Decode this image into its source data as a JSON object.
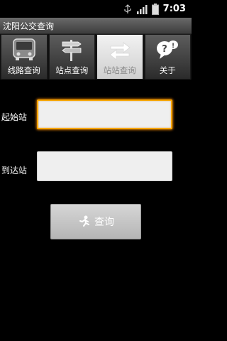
{
  "status_bar": {
    "time": "7:03",
    "icons": [
      "usb-icon",
      "signal-icon",
      "battery-icon"
    ]
  },
  "app": {
    "title": "沈阳公交查询"
  },
  "tabs": [
    {
      "label": "线路查询",
      "icon": "bus-icon",
      "active": false
    },
    {
      "label": "站点查询",
      "icon": "signpost-icon",
      "active": false
    },
    {
      "label": "站站查询",
      "icon": "swap-arrows-icon",
      "active": true
    },
    {
      "label": "关于",
      "icon": "question-bubble-icon",
      "active": false
    }
  ],
  "form": {
    "start_label": "起始站",
    "start_value": "",
    "end_label": "到达站",
    "end_value": "",
    "query_label": "查询",
    "query_icon": "runner-icon"
  },
  "colors": {
    "focus_border": "#f7a600",
    "background": "#000000"
  }
}
